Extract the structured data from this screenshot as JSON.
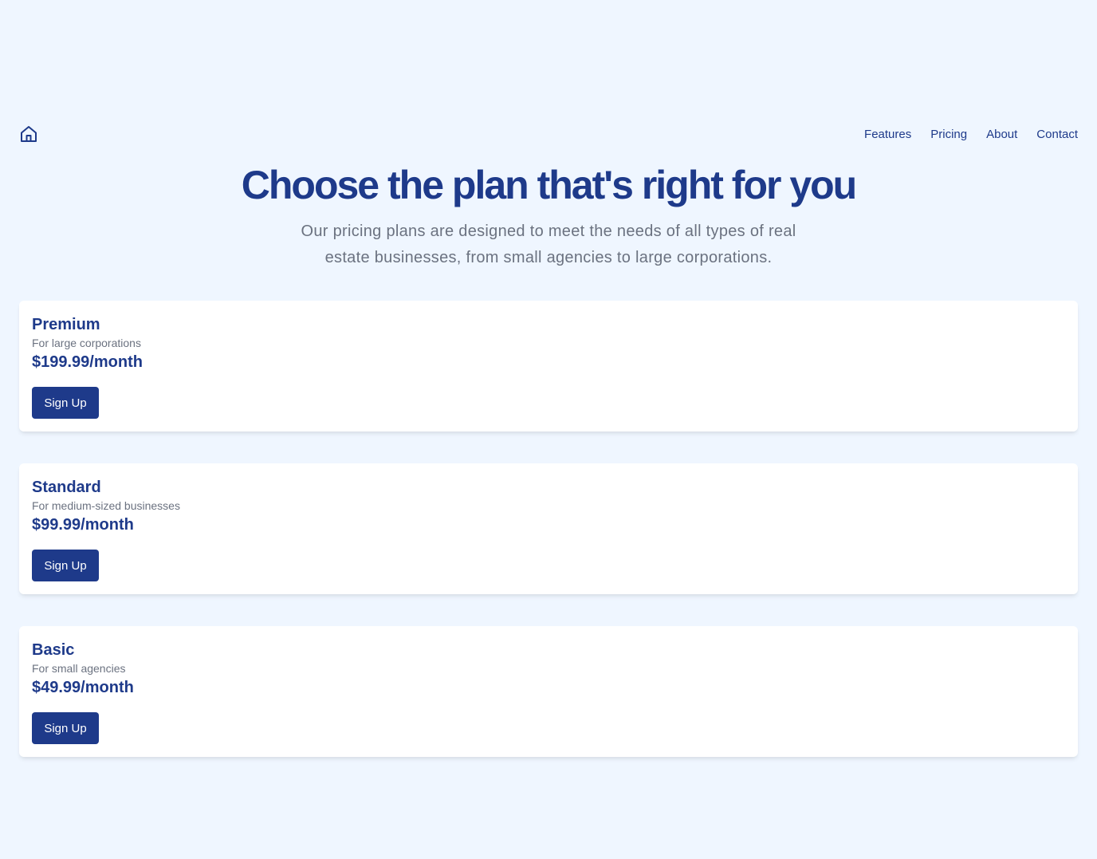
{
  "colors": {
    "background": "#eff6ff",
    "primary": "#1e3a8a",
    "muted_text": "#6b7280",
    "card": "#ffffff"
  },
  "navbar": {
    "logo_icon": "home-icon",
    "links": [
      {
        "label": "Features"
      },
      {
        "label": "Pricing"
      },
      {
        "label": "About"
      },
      {
        "label": "Contact"
      }
    ]
  },
  "hero": {
    "title": "Choose the plan that's right for you",
    "subtitle": "Our pricing plans are designed to meet the needs of all types of real estate businesses, from small agencies to large corporations."
  },
  "plans": [
    {
      "name": "Premium",
      "description": "For large corporations",
      "price": "$199.99/month",
      "button_label": "Sign Up"
    },
    {
      "name": "Standard",
      "description": "For medium-sized businesses",
      "price": "$99.99/month",
      "button_label": "Sign Up"
    },
    {
      "name": "Basic",
      "description": "For small agencies",
      "price": "$49.99/month",
      "button_label": "Sign Up"
    }
  ]
}
